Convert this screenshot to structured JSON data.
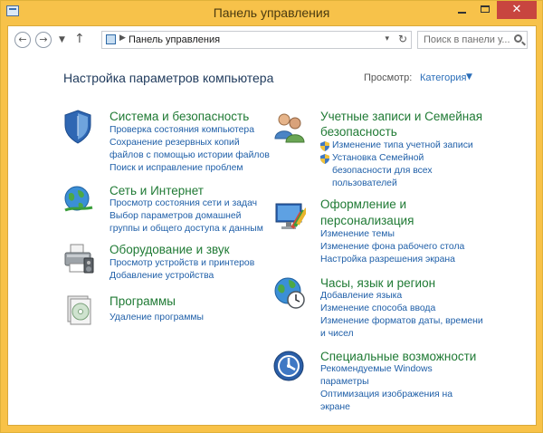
{
  "window": {
    "title": "Панель управления"
  },
  "address": {
    "path": "Панель управления",
    "search_placeholder": "Поиск в панели у..."
  },
  "heading": "Настройка параметров компьютера",
  "view_by": {
    "label": "Просмотр:",
    "value": "Категория"
  },
  "categories": [
    {
      "title": "Система и безопасность",
      "links": [
        "Проверка состояния компьютера",
        "Сохранение резервных копий",
        "файлов с помощью истории файлов",
        "Поиск и исправление проблем"
      ]
    },
    {
      "title": "Сеть и Интернет",
      "links": [
        "Просмотр состояния сети и задач",
        "Выбор параметров домашней",
        "группы и общего доступа к данным"
      ]
    },
    {
      "title": "Оборудование и звук",
      "links": [
        "Просмотр устройств и принтеров",
        "Добавление устройства"
      ]
    },
    {
      "title": "Программы",
      "links": [
        "Удаление программы"
      ]
    },
    {
      "title_lines": [
        "Учетные записи и Семейная",
        "безопасность"
      ],
      "links": [
        "Изменение типа учетной записи",
        "Установка Семейной",
        "безопасности для всех",
        "пользователей"
      ]
    },
    {
      "title_lines": [
        "Оформление и",
        "персонализация"
      ],
      "links": [
        "Изменение темы",
        "Изменение фона рабочего стола",
        "Настройка разрешения экрана"
      ]
    },
    {
      "title": "Часы, язык и регион",
      "links": [
        "Добавление языка",
        "Изменение способа ввода",
        "Изменение форматов даты, времени",
        "и чисел"
      ]
    },
    {
      "title": "Специальные возможности",
      "links": [
        "Рекомендуемые Windows",
        "параметры",
        "Оптимизация изображения на",
        "экране"
      ]
    }
  ],
  "colors": {
    "frame": "#f7c24a",
    "category_title": "#1f7a34",
    "link": "#1f5fa8",
    "heading": "#1e395b"
  }
}
